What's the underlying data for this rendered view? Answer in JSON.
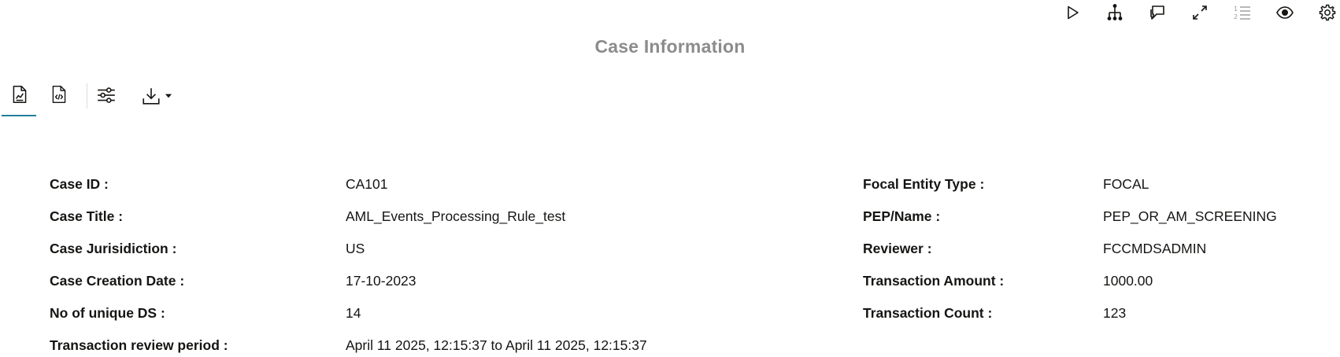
{
  "title": "Case Information",
  "toolbar_icons": [
    "play-icon",
    "hierarchy-icon",
    "comments-icon",
    "expand-icon",
    "numbered-list-icon",
    "eye-icon",
    "gear-icon"
  ],
  "view_toolbar_icons": [
    "report-document-icon",
    "code-document-icon",
    "sliders-icon",
    "download-icon",
    "caret-down-icon"
  ],
  "accent_color": "#227e9e",
  "left_fields": [
    {
      "label": "Case ID :",
      "value": "CA101"
    },
    {
      "label": "Case Title :",
      "value": "AML_Events_Processing_Rule_test"
    },
    {
      "label": "Case Jurisidiction :",
      "value": "US"
    },
    {
      "label": "Case Creation Date :",
      "value": "17-10-2023"
    },
    {
      "label": "No of unique DS :",
      "value": "14"
    },
    {
      "label": "Transaction review period :",
      "value": "April 11 2025, 12:15:37 to April 11 2025, 12:15:37"
    }
  ],
  "right_fields": [
    {
      "label": "Focal Entity Type :",
      "value": "FOCAL"
    },
    {
      "label": "PEP/Name :",
      "value": "PEP_OR_AM_SCREENING"
    },
    {
      "label": "Reviewer :",
      "value": "FCCMDSADMIN"
    },
    {
      "label": "Transaction Amount :",
      "value": "1000.00"
    },
    {
      "label": "Transaction Count :",
      "value": "123"
    }
  ]
}
